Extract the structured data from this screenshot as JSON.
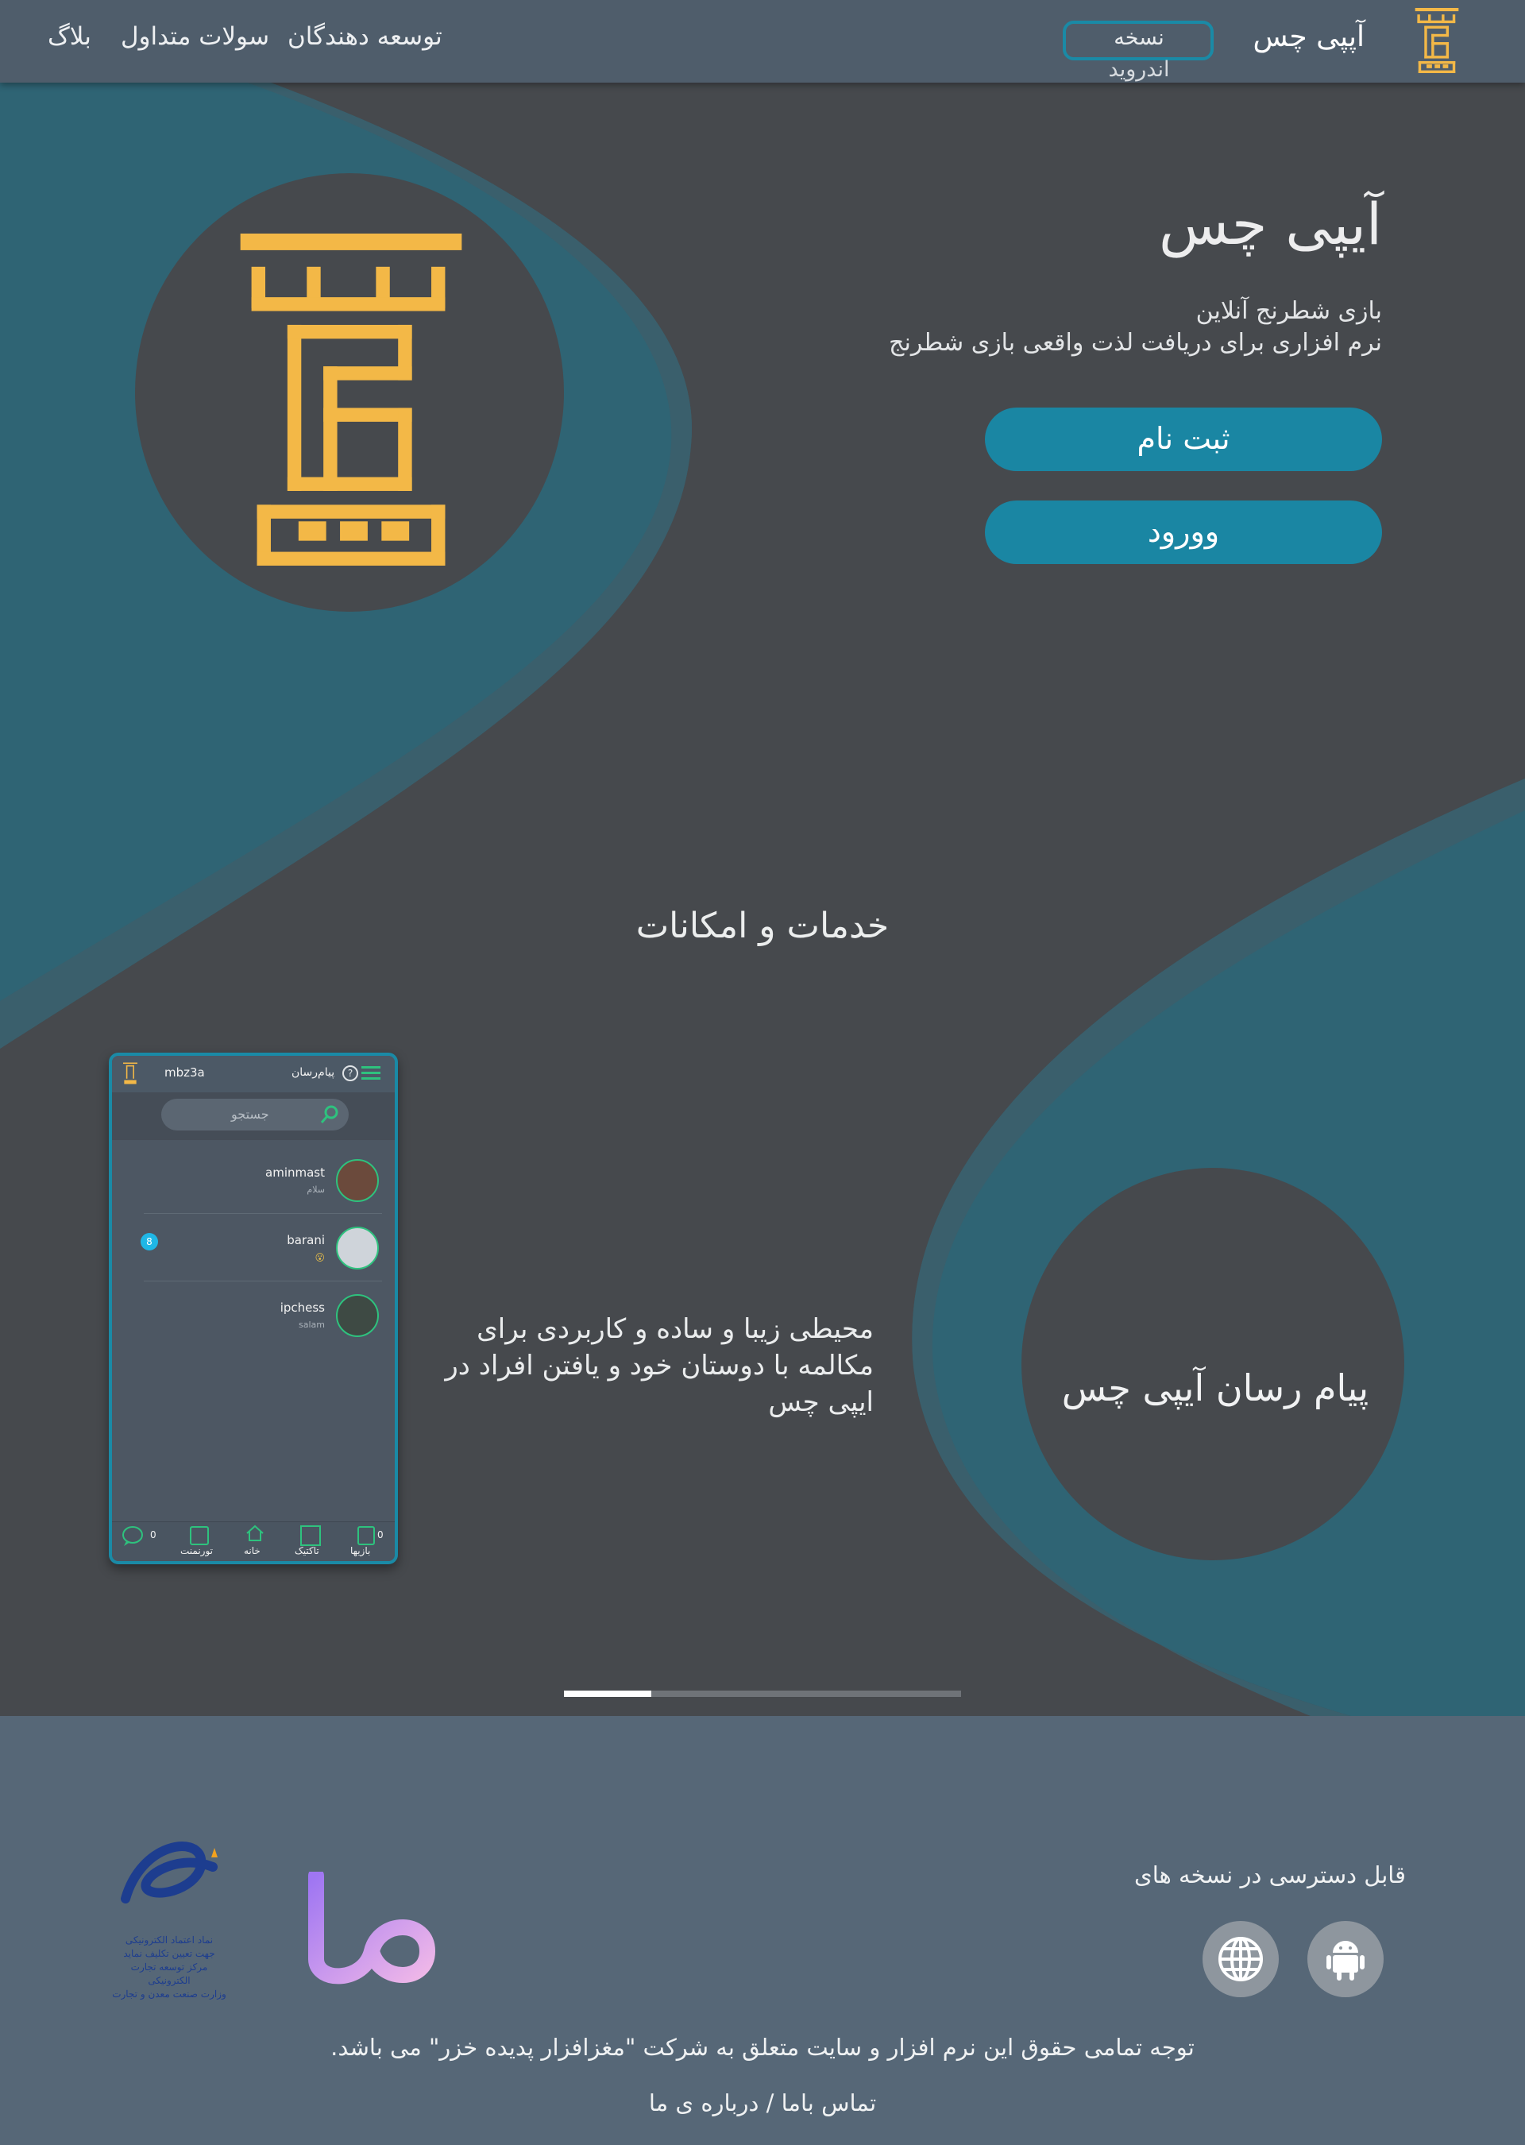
{
  "header": {
    "brand_name": "آپپی چس",
    "version_button_line1": "نسخه",
    "version_button_line2": "اندروید",
    "nav": [
      {
        "label": "توسعه دهندگان"
      },
      {
        "label": "سولات متداول"
      },
      {
        "label": "بلاگ"
      }
    ]
  },
  "hero": {
    "title": "آیپی چس",
    "subtitle_line1": "بازی شطرنج آنلاین",
    "subtitle_line2": "نرم افزاری برای دریافت لذت واقعی بازی شطرنج",
    "register_label": "ثبت نام",
    "login_label": "وورود"
  },
  "services": {
    "title": "خدمات و امکانات"
  },
  "slide": {
    "title": "پیام رسان آیپی چس",
    "description": "محیطی زیبا و ساده و کاربردی برای مکالمه با دوستان خود و یافتن افراد در ایپی چس",
    "progress": 0.22
  },
  "phone": {
    "username": "mbz3a",
    "screen_title": "پیام‌رسان",
    "search_placeholder": "جستجو",
    "contacts": [
      {
        "name": "aminmast",
        "message": "سلام",
        "badge": ""
      },
      {
        "name": "barani",
        "message": "😮",
        "badge": "8"
      },
      {
        "name": "ipchess",
        "message": "salam",
        "badge": ""
      }
    ],
    "bottom_nav": [
      {
        "label": "بازیها",
        "count": "0"
      },
      {
        "label": "تاکتیک",
        "count": ""
      },
      {
        "label": "خانه",
        "count": ""
      },
      {
        "label": "تورنمنت",
        "count": ""
      },
      {
        "label": "",
        "count": "0"
      }
    ]
  },
  "footer": {
    "available_text": "قابل دسترسی در نسخه های",
    "copyright": ".توجه تمامی حقوق این نرم افزار و سایت متعلق به شرکت \"مغزافزار پدیده خزر\" می باشد",
    "about_label": "درباره ی ما",
    "separator": "/",
    "contact_label": "تماس باما",
    "enamad_text_1": "نماد اعتماد الکترونیکی",
    "enamad_text_2": "جهت تعیین تکلیف نماید",
    "enamad_text_3": "مرکز توسعه تجارت الکترونیکی",
    "enamad_text_4": "وزارت صنعت معدن و تجارت"
  },
  "colors": {
    "background": "#46494d",
    "header": "#4f5d6b",
    "accent": "#1a86a3",
    "gold": "#f3b847",
    "wave": "#2f6474",
    "footer": "#566777"
  },
  "icons": {
    "logo": "rook-logo-icon",
    "android": "android-icon",
    "web": "globe-icon",
    "search": "search-icon"
  }
}
